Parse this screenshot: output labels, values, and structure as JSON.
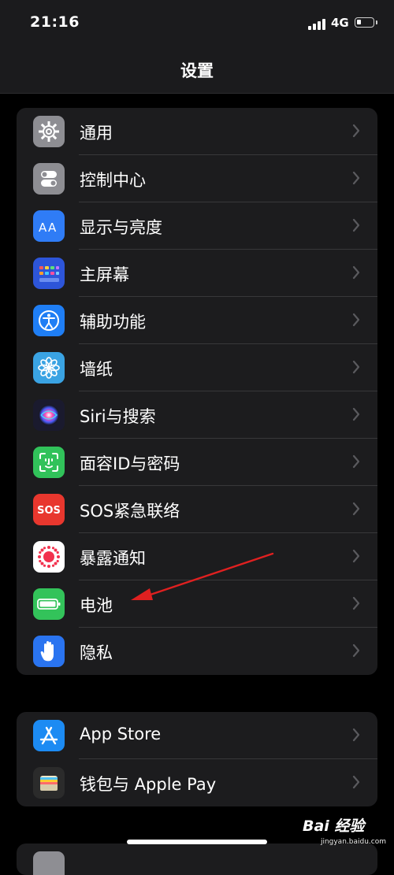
{
  "status_bar": {
    "time": "21:16",
    "network": "4G",
    "battery_level": 0.3
  },
  "header": {
    "title": "设置"
  },
  "groups": [
    {
      "items": [
        {
          "label": "通用",
          "icon": "gear-icon",
          "color": "#8e8e93"
        },
        {
          "label": "控制中心",
          "icon": "toggle-switches-icon",
          "color": "#8e8e93"
        },
        {
          "label": "显示与亮度",
          "icon": "text-size-icon",
          "color": "#2f7cf6"
        },
        {
          "label": "主屏幕",
          "icon": "app-grid-icon",
          "color": "#2d55d9"
        },
        {
          "label": "辅助功能",
          "icon": "accessibility-icon",
          "color": "#1f7ef5"
        },
        {
          "label": "墙纸",
          "icon": "flower-icon",
          "color": "#3aa3e3"
        },
        {
          "label": "Siri与搜索",
          "icon": "siri-icon",
          "color": "#1a1a2e"
        },
        {
          "label": "面容ID与密码",
          "icon": "face-id-icon",
          "color": "#31c25a"
        },
        {
          "label": "SOS紧急联络",
          "icon": "sos-icon",
          "color": "#e8372e"
        },
        {
          "label": "暴露通知",
          "icon": "exposure-notification-icon",
          "color": "#ffffff"
        },
        {
          "label": "电池",
          "icon": "battery-icon",
          "color": "#33c35a"
        },
        {
          "label": "隐私",
          "icon": "hand-icon",
          "color": "#2a74f0"
        }
      ]
    },
    {
      "items": [
        {
          "label": "App Store",
          "icon": "app-store-icon",
          "color": "#1c8bf3"
        },
        {
          "label": "钱包与 Apple Pay",
          "icon": "wallet-icon",
          "color": "#2b2b2b"
        }
      ]
    }
  ],
  "watermark": {
    "logo": "Bai 经验",
    "sub": "jingyan.baidu.com"
  },
  "annotation_color": "#e02020"
}
